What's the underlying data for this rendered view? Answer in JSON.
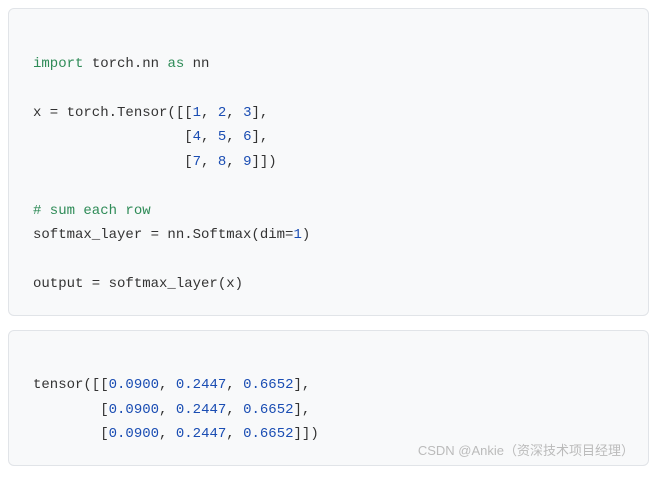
{
  "code1": {
    "t01": "import",
    "t02": " torch.nn ",
    "t03": "as",
    "t04": " nn",
    "t05": "x = torch.Tensor([[",
    "t06": "1",
    "t07": ", ",
    "t08": "2",
    "t09": ", ",
    "t10": "3",
    "t11": "],",
    "t12": "                  [",
    "t13": "4",
    "t14": ", ",
    "t15": "5",
    "t16": ", ",
    "t17": "6",
    "t18": "],",
    "t19": "                  [",
    "t20": "7",
    "t21": ", ",
    "t22": "8",
    "t23": ", ",
    "t24": "9",
    "t25": "]])",
    "t26": "# sum each row",
    "t27": "softmax_layer = nn.Softmax(dim=",
    "t28": "1",
    "t29": ")",
    "t30": "output = softmax_layer(x)"
  },
  "code2": {
    "t01": "tensor([[",
    "t02": "0.0900",
    "t03": ", ",
    "t04": "0.2447",
    "t05": ", ",
    "t06": "0.6652",
    "t07": "],",
    "t08": "        [",
    "t09": "0.0900",
    "t10": ", ",
    "t11": "0.2447",
    "t12": ", ",
    "t13": "0.6652",
    "t14": "],",
    "t15": "        [",
    "t16": "0.0900",
    "t17": ", ",
    "t18": "0.2447",
    "t19": ", ",
    "t20": "0.6652",
    "t21": "]])"
  },
  "watermark": "CSDN @Ankie（资深技术项目经理）"
}
